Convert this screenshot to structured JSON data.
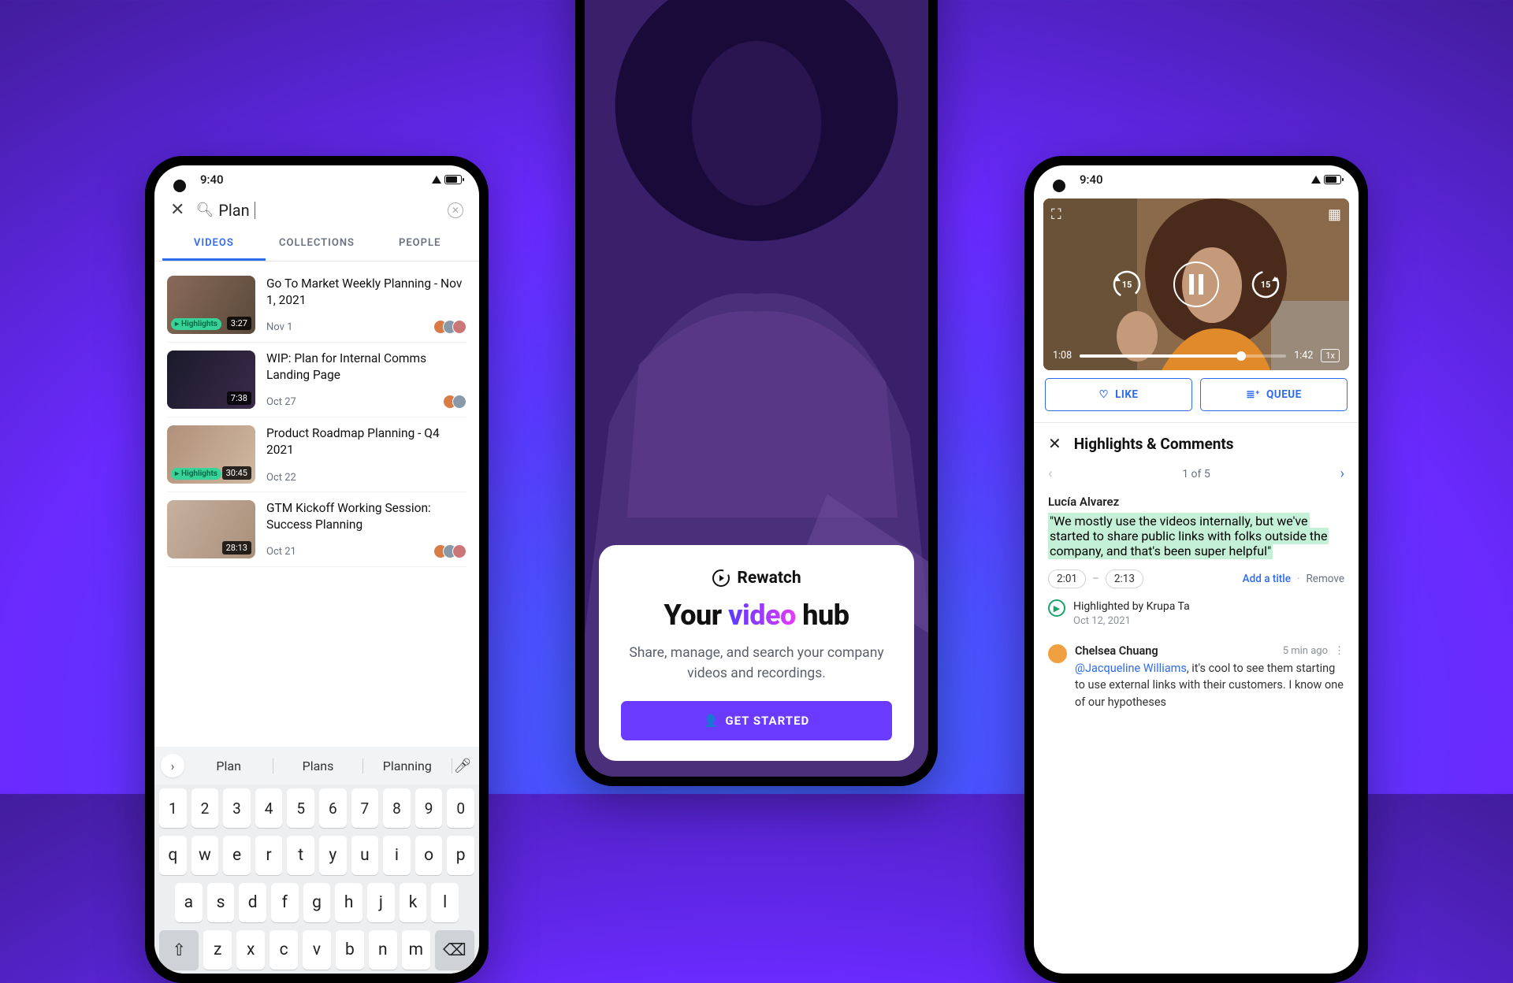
{
  "status_time": "9:40",
  "left": {
    "search_value": "Plan",
    "tabs": [
      "VIDEOS",
      "COLLECTIONS",
      "PEOPLE"
    ],
    "active_tab": 0,
    "results": [
      {
        "title": "Go To Market Weekly Planning - Nov 1, 2021",
        "date": "Nov 1",
        "duration": "3:27",
        "highlights": "Highlights"
      },
      {
        "title": "WIP: Plan for Internal Comms Landing Page",
        "date": "Oct 27",
        "duration": "7:38",
        "highlights": ""
      },
      {
        "title": "Product Roadmap Planning - Q4 2021",
        "date": "Oct 22",
        "duration": "30:45",
        "highlights": "Highlights"
      },
      {
        "title": "GTM Kickoff Working Session: Success Planning",
        "date": "Oct 21",
        "duration": "28:13",
        "highlights": ""
      }
    ],
    "suggestions": [
      "Plan",
      "Plans",
      "Planning"
    ],
    "keyboard": {
      "r1": [
        "1",
        "2",
        "3",
        "4",
        "5",
        "6",
        "7",
        "8",
        "9",
        "0"
      ],
      "r2": [
        "q",
        "w",
        "e",
        "r",
        "t",
        "y",
        "u",
        "i",
        "o",
        "p"
      ],
      "r3": [
        "a",
        "s",
        "d",
        "f",
        "g",
        "h",
        "j",
        "k",
        "l"
      ],
      "r4_shift": "⇧",
      "r4": [
        "z",
        "x",
        "c",
        "v",
        "b",
        "n",
        "m"
      ],
      "r4_del": "⌫"
    }
  },
  "center": {
    "brand": "Rewatch",
    "headline_pre": "Your ",
    "headline_em": "video",
    "headline_post": " hub",
    "sub": "Share, manage, and search your company videos and recordings.",
    "cta": "GET STARTED"
  },
  "right": {
    "elapsed": "1:08",
    "total": "1:42",
    "speed": "1x",
    "seek_back": "15",
    "seek_fwd": "15",
    "like": "LIKE",
    "queue": "QUEUE",
    "section": "Highlights & Comments",
    "pager": "1 of 5",
    "highlight": {
      "author": "Lucía Alvarez",
      "quote": "\"We mostly use the videos internally, but we've started to share public links with folks outside the company, and that's been super helpful\"",
      "t_start": "2:01",
      "t_end": "2:13",
      "add_title": "Add a title",
      "remove": "Remove",
      "by_label": "Highlighted by Krupa Ta",
      "by_date": "Oct 12, 2021"
    },
    "comment": {
      "author": "Chelsea Chuang",
      "ago": "5 min ago",
      "mention": "@Jacqueline Williams",
      "body": ", it's cool to see them starting to use external links with their customers. I know one of our hypotheses"
    }
  }
}
